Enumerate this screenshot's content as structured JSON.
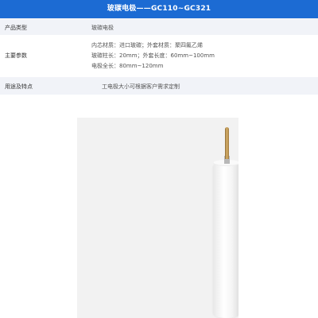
{
  "title": "玻碳电极——GC110~GC321",
  "rows": [
    {
      "label": "产品类型",
      "value": "玻碳电极"
    },
    {
      "label": "主要参数",
      "lines": [
        "内芯材质：进口玻碳；外套材质：聚四氟乙烯",
        "玻碳柱长：20mm；外套长度：60mm~100mm",
        "电极全长：80mm~120mm"
      ]
    },
    {
      "label": "用途及特点",
      "value": "工电极大小可根据客户需求定制"
    }
  ],
  "colors": {
    "title_bg": "#1c6bd3",
    "row_alt_bg": "#f1f3f8"
  }
}
